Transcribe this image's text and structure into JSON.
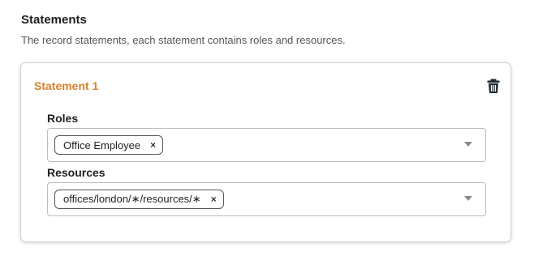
{
  "section": {
    "title": "Statements",
    "description": "The record statements, each statement contains roles and resources."
  },
  "statement": {
    "title": "Statement 1",
    "delete_icon": "trash-icon",
    "accent_color": "#d9822b",
    "roles": {
      "label": "Roles",
      "chips": [
        {
          "label": "Office Employee",
          "remove": "×"
        }
      ],
      "dropdown_icon": "chevron-down-icon"
    },
    "resources": {
      "label": "Resources",
      "chips": [
        {
          "label": "offices/london/∗/resources/∗",
          "remove": "×"
        }
      ],
      "dropdown_icon": "chevron-down-icon"
    }
  }
}
